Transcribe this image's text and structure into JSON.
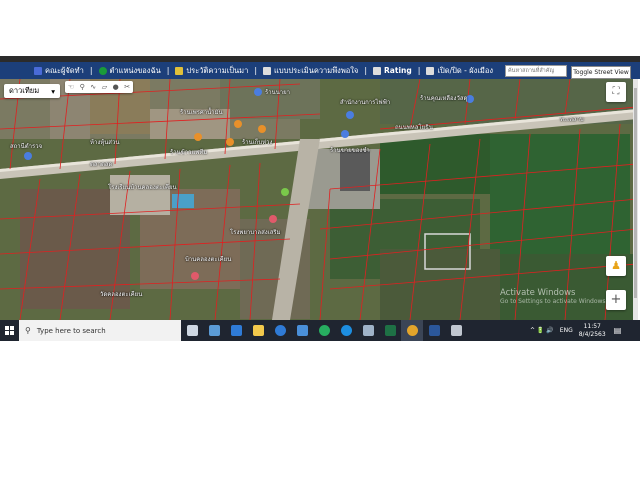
{
  "toolbar": {
    "items": [
      {
        "label": "คณะผู้จัดทำ",
        "icon": "user-group-icon",
        "color": "#4a6bd8"
      },
      {
        "label": "ตำแหน่งของฉัน",
        "icon": "location-globe-icon",
        "color": "#1a9b3a"
      },
      {
        "label": "ประวัติความเป็นมา",
        "icon": "history-icon",
        "color": "#e0c03a"
      },
      {
        "label": "แบบประเมินความพึงพอใจ",
        "icon": "form-icon",
        "color": "#dddddd"
      },
      {
        "label": "Rating",
        "icon": "rating-chart-icon",
        "color": "#dddddd"
      },
      {
        "label": "เปิด/ปิด - ผังเมือง",
        "icon": "layer-toggle-icon",
        "color": "#dddddd"
      }
    ],
    "search_placeholder": "ค้นหาสถานที่สำคัญ",
    "street_view_label": "Toggle Street View"
  },
  "map": {
    "type_selector": "ดาวเทียม",
    "type_chevron": "▾",
    "tools": [
      "☜",
      "⚲",
      "∿",
      "▱",
      "●",
      "✂"
    ],
    "fullscreen_glyph": "⛶",
    "pegman_glyph": "♟",
    "zoom_in_label": "+",
    "labels": [
      "ร้านนายา",
      "ร้านเพรศาน้ำมัน",
      "สำนักงานการไฟฟ้า",
      "ร้านคุณเหลืองวัสดุ",
      "ร้านข้าวแพทีม",
      "ร้านเก็บห่วง",
      "ร้านขายของชำ",
      "โรงเรียนบ้านคลองตะเคียน",
      "โรงพยาบาลส่งเสริม",
      "บ้านคลองตะเคียน",
      "วัดคลองตะเคียน",
      "สถานีตำรวจ",
      "ถนนพหลโยธิน",
      "ตลาดสด",
      "ห้างหุ้นส่วน",
      "ทะเลสาบ"
    ],
    "watermark_title": "Activate Windows",
    "watermark_sub": "Go to Settings to activate Windows."
  },
  "taskbar": {
    "search_placeholder": "Type here to search",
    "apps": [
      {
        "name": "task-view-icon",
        "color": "#cfd8e3"
      },
      {
        "name": "store-icon",
        "color": "#5b9bd5"
      },
      {
        "name": "mail-icon",
        "color": "#2f7bd6"
      },
      {
        "name": "file-explorer-icon",
        "color": "#f2c94c"
      },
      {
        "name": "edge-legacy-icon",
        "color": "#2f7bd6"
      },
      {
        "name": "photos-icon",
        "color": "#4a90d9"
      },
      {
        "name": "line-icon",
        "color": "#27ae60"
      },
      {
        "name": "edge-icon",
        "color": "#1d8ee0"
      },
      {
        "name": "media-icon",
        "color": "#9fb3c8"
      },
      {
        "name": "excel-icon",
        "color": "#1e7145"
      },
      {
        "name": "chrome-icon",
        "color": "#e3a52b"
      },
      {
        "name": "word-icon",
        "color": "#2b579a"
      },
      {
        "name": "snip-icon",
        "color": "#c0c7d0"
      }
    ],
    "tray_glyphs": "^ 🔋 🔊",
    "language": "ENG",
    "time": "11:57",
    "date": "8/4/2563"
  }
}
